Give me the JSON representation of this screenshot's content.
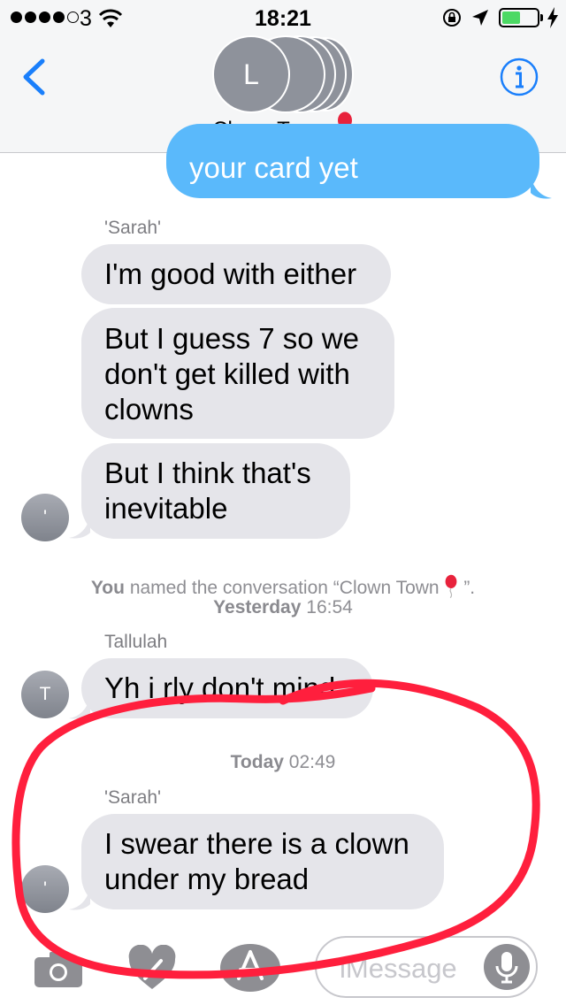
{
  "status_bar": {
    "carrier": "3",
    "time": "18:21"
  },
  "header": {
    "avatar_initial": "L",
    "group_name": "Clown Town",
    "balloon_emoji": "🎈"
  },
  "messages": {
    "outgoing_partial": "your card yet",
    "sender_sarah": "'Sarah'",
    "msg1": "I'm good with either",
    "msg2_line1": "But I guess 7 so we",
    "msg2_line2": "don't get killed with",
    "msg2_line3": "clowns",
    "msg3_line1": "But I think that's",
    "msg3_line2": "inevitable",
    "rename_you": "You",
    "rename_text": "named the conversation “Clown Town",
    "rename_end": "”.",
    "ts1_day": "Yesterday",
    "ts1_time": "16:54",
    "sender_tallulah": "Tallulah",
    "tallulah_initial": "T",
    "msg4": "Yh i rly don't mind",
    "ts2_day": "Today",
    "ts2_time": "02:49",
    "sender_sarah2": "'Sarah'",
    "msg5_line1": "I swear there is a clown",
    "msg5_line2": "under my bread",
    "sarah_avatar_mark": "'"
  },
  "input_bar": {
    "placeholder": "iMessage"
  },
  "colors": {
    "ios_blue": "#1a7ffb",
    "outgoing_bubble": "#5ab9fb",
    "incoming_bubble": "#e5e5ea",
    "battery_green": "#4cd964",
    "annotation_red": "#ff1f3d"
  }
}
